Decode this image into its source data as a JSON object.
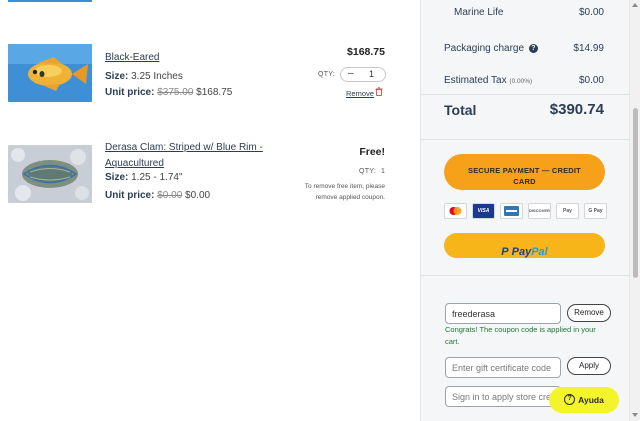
{
  "items": [
    {
      "name": "Black-Eared",
      "size_label": "Size:",
      "size_value": "3.25 Inches",
      "unit_price_label": "Unit price:",
      "original_price": "$375.00",
      "sale_price": "$168.75",
      "line_total": "$168.75",
      "qty_label": "QTY:",
      "qty_value": "1",
      "stepper_minus": "–",
      "remove_label": "Remove"
    },
    {
      "name_line1": "Derasa Clam: Striped w/ Blue Rim -",
      "name_line2": "Aquacultured",
      "size_label": "Size:",
      "size_value": "1.25 - 1.74\"",
      "unit_price_label": "Unit price:",
      "original_price": "$0.00",
      "sale_price": "$0.00",
      "line_total": "Free!",
      "qty_label": "QTY:",
      "qty_value": "1",
      "note_line1": "To remove free item, please",
      "note_line2": "remove applied coupon."
    }
  ],
  "summary": {
    "marine_life_label": "Marine Life",
    "marine_life_amount": "$0.00",
    "packaging_label": "Packaging charge",
    "packaging_help": "?",
    "packaging_amount": "$14.99",
    "tax_label": "Estimated Tax",
    "tax_rate": "(0.00%)",
    "tax_amount": "$0.00",
    "total_label": "Total",
    "total_amount": "$390.74"
  },
  "checkout": {
    "secure_line1": "SECURE PAYMENT — CREDIT",
    "secure_line2": "CARD",
    "cards": [
      "VISA",
      "DISCOVER",
      "Pay",
      "G Pay"
    ],
    "paypal_part1": "Pay",
    "paypal_part2": "Pal",
    "paypal_icon": "P"
  },
  "coupon": {
    "value": "freederasa",
    "remove_label": "Remove",
    "message": "Congrats! The coupon code is applied in your cart."
  },
  "gift": {
    "placeholder": "Enter gift certificate code",
    "apply_label": "Apply"
  },
  "store_credit": {
    "placeholder": "Sign in to apply store credit"
  },
  "help": {
    "icon": "?",
    "label": "Ayuda"
  },
  "colors": {
    "accent_orange": "#f7a11a",
    "paypal_yellow": "#f7b519",
    "help_yellow": "#f4f42a",
    "navy": "#2b3e57",
    "success_green": "#1f7a3a"
  }
}
